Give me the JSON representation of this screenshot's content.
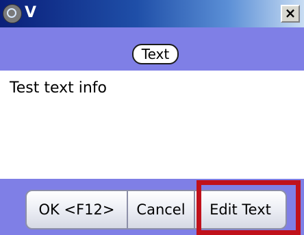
{
  "window": {
    "title": "V",
    "close_label": "×"
  },
  "header": {
    "pill_label": "Text"
  },
  "content": {
    "text": "Test text info"
  },
  "buttons": {
    "ok_label": "OK <F12>",
    "cancel_label": "Cancel",
    "edit_label": "Edit Text"
  },
  "colors": {
    "band": "#7f7fe6",
    "highlight": "#c0111b",
    "titlebar_start": "#0a1f7a",
    "titlebar_end": "#c9ddf3"
  },
  "icons": {
    "app": "globe-icon",
    "close": "close-icon"
  }
}
